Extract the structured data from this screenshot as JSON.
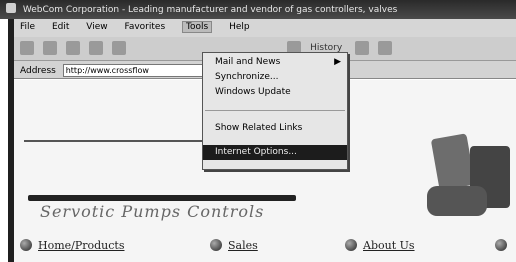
{
  "window": {
    "title": "WebCom Corporation - Leading manufacturer and vendor of gas controllers, valves"
  },
  "menubar": {
    "items": [
      "File",
      "Edit",
      "View",
      "Favorites",
      "Tools",
      "Help"
    ]
  },
  "toolbar": {
    "history_label": "History"
  },
  "addressbar": {
    "label": "Address",
    "url": "http://www.crossflow"
  },
  "tools_menu": {
    "items": [
      {
        "label": "Mail and News",
        "arrow": "▶"
      },
      {
        "label": "Synchronize..."
      },
      {
        "label": "Windows Update"
      },
      {
        "label": "Show Related Links"
      },
      {
        "label": "Internet Options..."
      }
    ]
  },
  "site": {
    "logo_text": "Servotic Pumps Controls",
    "nav": [
      {
        "label": "Home/Products"
      },
      {
        "label": "Sales"
      },
      {
        "label": "About Us"
      }
    ]
  }
}
